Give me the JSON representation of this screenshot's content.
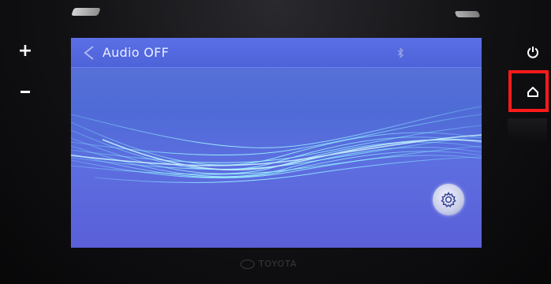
{
  "screen": {
    "title": "Audio OFF",
    "icons": {
      "back": "back-arrow-icon",
      "bluetooth": "bluetooth-icon",
      "settings": "gear-icon"
    }
  },
  "side_panel": {
    "left": [
      {
        "label": "+",
        "icon": "volume-up-icon"
      },
      {
        "label": "",
        "icon": "volume-down-icon"
      }
    ],
    "right": [
      {
        "icon": "power-icon"
      },
      {
        "icon": "home-icon",
        "highlighted": true
      }
    ]
  },
  "bezel": {
    "brand": "TOYOTA"
  },
  "colors": {
    "screen_bg": "#5a6cdc",
    "header_bg": "#4e63d8",
    "highlight": "#ff1a1a",
    "bezel": "#111114"
  }
}
